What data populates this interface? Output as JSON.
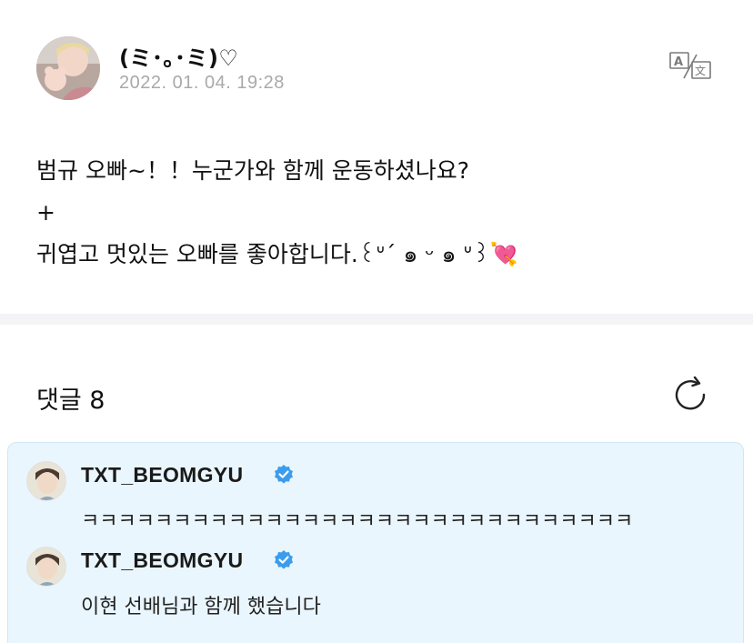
{
  "post": {
    "author": "(ミ･｡･ミ)♡",
    "date": "2022. 01. 04. 19:28",
    "body_lines": [
      "범규 오빠~！！누군가와 함께 운동하셨나요?",
      "+",
      "귀엽고 멋있는 오빠를 좋아합니다.꒰ᐡ´ ๑ ᵕ ๑ ᐡ꒱💘"
    ]
  },
  "comments_header": {
    "label": "댓글 8"
  },
  "comments": [
    {
      "name": "TXT_BEOMGYU",
      "text": "ㅋㅋㅋㅋㅋㅋㅋㅋㅋㅋㅋㅋㅋㅋㅋㅋㅋㅋㅋㅋㅋㅋㅋㅋㅋㅋㅋㅋㅋㅋ"
    },
    {
      "name": "TXT_BEOMGYU",
      "text": "이현 선배님과 함께 했습니다"
    }
  ],
  "icons": {
    "translate": "translate-icon",
    "refresh": "refresh-icon",
    "verified": "verified-badge-icon"
  },
  "colors": {
    "verified_blue": "#3b9ced",
    "highlight_bg": "#eaf6fd",
    "date_gray": "#a9a9a9"
  }
}
